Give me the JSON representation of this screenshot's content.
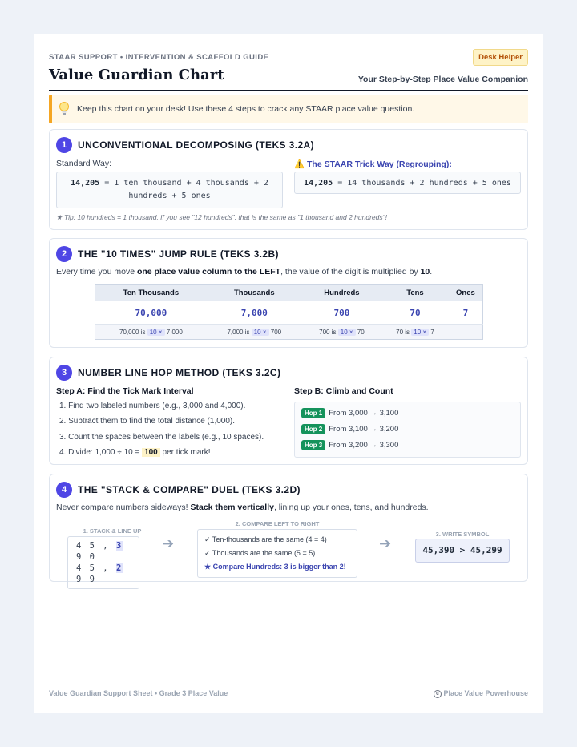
{
  "header": {
    "kicker": "STAAR SUPPORT • INTERVENTION & SCAFFOLD GUIDE",
    "badge": "Desk Helper",
    "title": "Value Guardian Chart",
    "tagline": "Your Step-by-Step Place Value Companion"
  },
  "tip": {
    "icon": "lightbulb-icon",
    "text": "Keep this chart on your desk! Use these 4 steps to crack any STAAR place value question."
  },
  "section1": {
    "number": "1",
    "title": "UNCONVENTIONAL DECOMPOSING (TEKS 3.2A)",
    "standard_label": "Standard Way:",
    "standard_eq_bold": "14,205",
    "standard_eq_rest": " = 1 ten thousand + 4 thousands + 2 hundreds + 5 ones",
    "trick_icon": "warning-icon",
    "trick_label": "The STAAR Trick Way (Regrouping):",
    "trick_eq_bold": "14,205",
    "trick_eq_rest": " = 14 thousands + 2 hundreds + 5 ones",
    "note": "★ Tip: 10 hundreds = 1 thousand. If you see \"12 hundreds\", that is the same as \"1 thousand and 2 hundreds\"!"
  },
  "section2": {
    "number": "2",
    "title": "THE \"10 TIMES\" JUMP RULE (TEKS 3.2B)",
    "intro_a": "Every time you move ",
    "intro_b": "one place value column to the LEFT",
    "intro_c": ", the value of the digit is multiplied by ",
    "intro_d": "10",
    "intro_e": ".",
    "columns": [
      "Ten Thousands",
      "Thousands",
      "Hundreds",
      "Tens",
      "Ones"
    ],
    "values": [
      "70,000",
      "7,000",
      "700",
      "70",
      "7"
    ],
    "relations": [
      {
        "a": "70,000 is",
        "m": "10 ×",
        "b": "7,000"
      },
      {
        "a": "7,000 is",
        "m": "10 ×",
        "b": "700"
      },
      {
        "a": "700 is",
        "m": "10 ×",
        "b": "70"
      },
      {
        "a": "70 is",
        "m": "10 ×",
        "b": "7"
      }
    ]
  },
  "section3": {
    "number": "3",
    "title": "NUMBER LINE HOP METHOD (TEKS 3.2C)",
    "stepA_label": "Step A: Find the Tick Mark Interval",
    "steps": [
      "1. Find two labeled numbers (e.g., 3,000 and 4,000).",
      "2. Subtract them to find the total distance (1,000).",
      "3. Count the spaces between the labels (e.g., 10 spaces).",
      "4. Divide: 1,000 ÷ 10 = "
    ],
    "step4_highlight": "100",
    "step4_tail": " per tick mark!",
    "stepB_label": "Step B: Climb and Count",
    "hops": [
      {
        "tag": "Hop 1",
        "text": "From 3,000 → 3,100"
      },
      {
        "tag": "Hop 2",
        "text": "From 3,100 → 3,200"
      },
      {
        "tag": "Hop 3",
        "text": "From 3,200 → 3,300"
      }
    ]
  },
  "section4": {
    "number": "4",
    "title": "THE \"STACK & COMPARE\" DUEL (TEKS 3.2D)",
    "intro_a": "Never compare numbers sideways! ",
    "intro_b": "Stack them vertically",
    "intro_c": ", lining up your ones, tens, and hundreds.",
    "stack_label": "1. STACK & LINE UP",
    "row1_pre": "4 5 , ",
    "row1_hd": "3",
    "row1_post": " 9 0",
    "row2_pre": "4 5 , ",
    "row2_hd": "2",
    "row2_post": " 9 9",
    "compare_label": "2. COMPARE LEFT TO RIGHT",
    "compare_lines": [
      "✓ Ten-thousands are the same (4 = 4)",
      "✓ Thousands are the same (5 = 5)",
      "★ Compare Hundreds: 3 is bigger than 2!"
    ],
    "symbol_label": "3. WRITE SYMBOL",
    "symbol": "45,390 > 45,299",
    "arrow_icon": "right-arrow-icon"
  },
  "footer": {
    "left": "Value Guardian Support Sheet • Grade 3 Place Value",
    "right_icon": "copyright-icon",
    "right": "Place Value Powerhouse"
  },
  "colors": {
    "accent": "#4f46e5",
    "tip_border": "#f5a623",
    "hop_green": "#15935c",
    "badge_bg": "#fef3c7"
  }
}
